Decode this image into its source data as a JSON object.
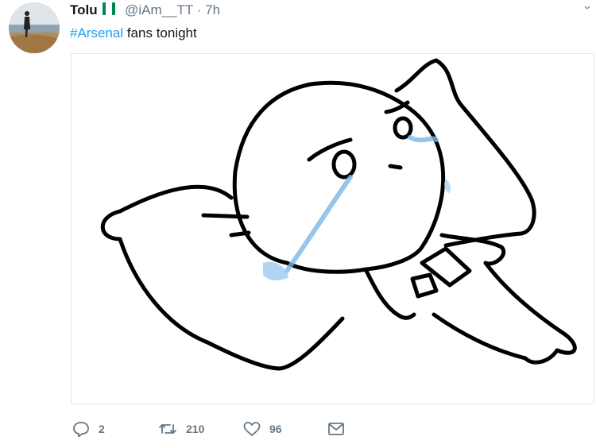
{
  "tweet": {
    "display_name": "Tolu",
    "handle": "@iAm__TT",
    "separator": "·",
    "time": "7h",
    "hashtag": "#Arsenal",
    "body_text": " fans tonight",
    "media_icon": "crying-cartoon-on-pillow-image"
  },
  "actions": {
    "reply_count": "2",
    "retweet_count": "210",
    "like_count": "96"
  },
  "colors": {
    "link": "#1da1f2",
    "secondary_text": "#657786",
    "border": "#e1e8ed",
    "flag_green": "#008751"
  }
}
